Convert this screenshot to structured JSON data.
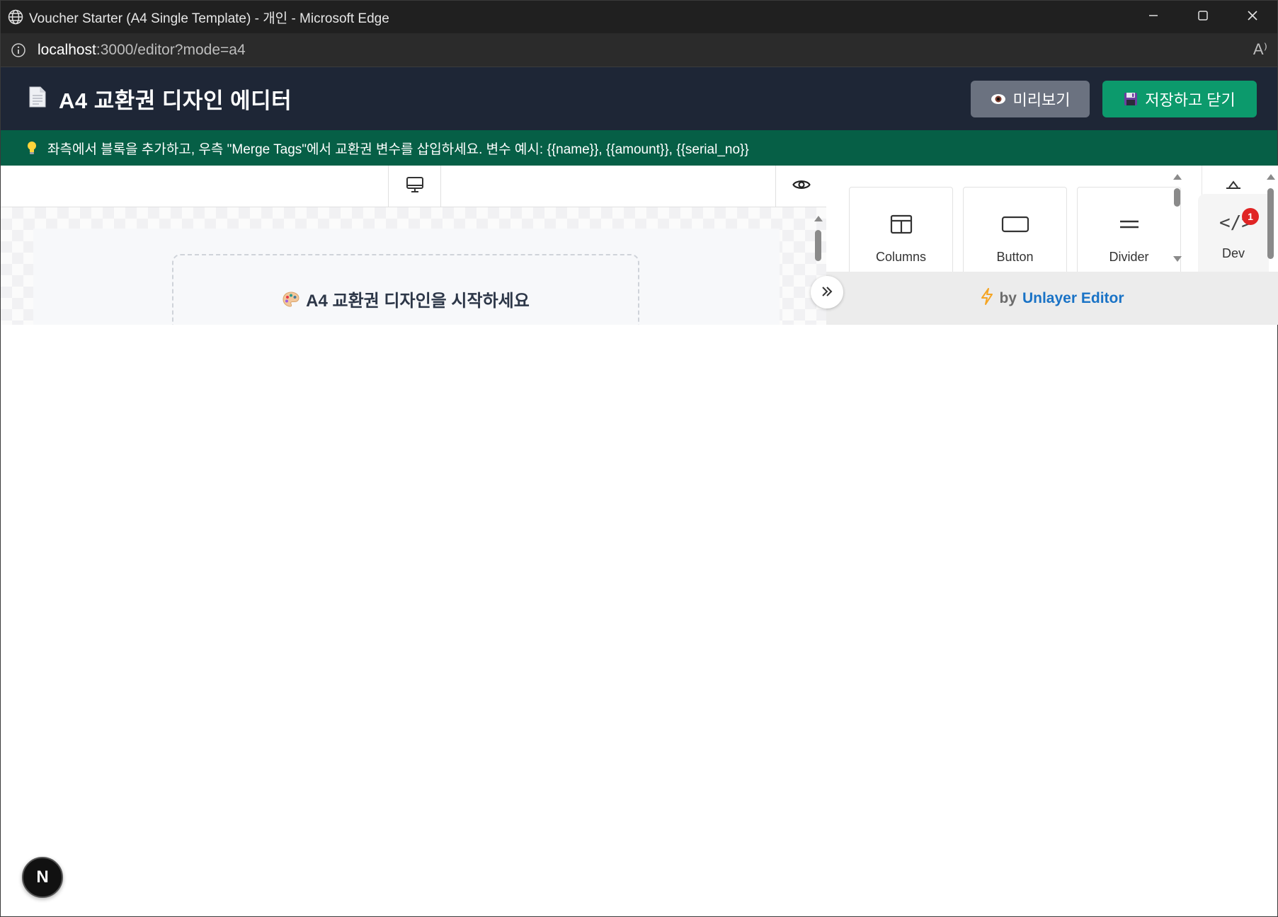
{
  "browser": {
    "window_title": "Voucher Starter (A4 Single Template) - 개인 - Microsoft Edge",
    "url_host": "localhost",
    "url_rest": ":3000/editor?mode=a4",
    "read_aloud_glyph": "A⁾"
  },
  "header": {
    "title": "A4 교환권 디자인 에디터",
    "preview_label": "미리보기",
    "save_label": "저장하고 닫기"
  },
  "hint": {
    "text": "좌측에서 블록을 추가하고, 우측 \"Merge Tags\"에서 교환권 변수를 삽입하세요. 변수 예시: {{name}}, {{amount}}, {{serial_no}}"
  },
  "canvas": {
    "placeholder_title": "A4 교환권 디자인을 시작하세요"
  },
  "tools": [
    {
      "label": "Columns",
      "icon": "columns-icon"
    },
    {
      "label": "Button",
      "icon": "button-icon"
    },
    {
      "label": "Divider",
      "icon": "divider-icon"
    }
  ],
  "side_tabs": {
    "dev_label": "Dev",
    "dev_badge": "1"
  },
  "panel_footer": {
    "by": "by",
    "brand": "Unlayer Editor"
  },
  "nextjs": {
    "label": "N"
  },
  "colors": {
    "app_header": "#1e2636",
    "hint_bar": "#065f46",
    "save_button": "#0c9a6c",
    "preview_button": "#6b7280",
    "brand_link": "#1a73c6",
    "badge": "#e02424"
  }
}
